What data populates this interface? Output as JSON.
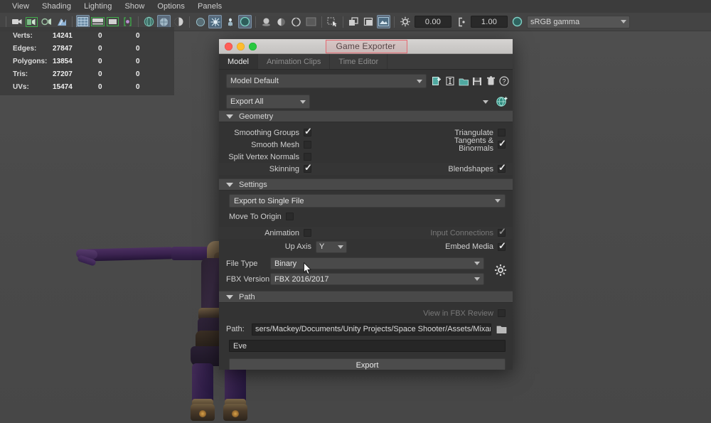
{
  "menubar": {
    "items": [
      {
        "label": "View"
      },
      {
        "label": "Shading"
      },
      {
        "label": "Lighting"
      },
      {
        "label": "Show"
      },
      {
        "label": "Options"
      },
      {
        "label": "Panels"
      }
    ]
  },
  "toolbar": {
    "translate_value": "0.00",
    "scale_value": "1.00",
    "color_space": "sRGB gamma"
  },
  "hud": {
    "columns": [
      "name",
      "col1",
      "col2",
      "col3"
    ],
    "rows": [
      {
        "label": "Verts:",
        "v1": "14241",
        "v2": "0",
        "v3": "0"
      },
      {
        "label": "Edges:",
        "v1": "27847",
        "v2": "0",
        "v3": "0"
      },
      {
        "label": "Polygons:",
        "v1": "13854",
        "v2": "0",
        "v3": "0"
      },
      {
        "label": "Tris:",
        "v1": "27207",
        "v2": "0",
        "v3": "0"
      },
      {
        "label": "UVs:",
        "v1": "15474",
        "v2": "0",
        "v3": "0"
      }
    ]
  },
  "dialog": {
    "title": "Game Exporter",
    "title_highlight_color": "#e46a72",
    "tabs": [
      {
        "label": "Model",
        "active": true
      },
      {
        "label": "Animation Clips",
        "active": false
      },
      {
        "label": "Time Editor",
        "active": false
      }
    ],
    "preset": {
      "value": "Model Default",
      "icons": [
        {
          "name": "new-preset-icon"
        },
        {
          "name": "rename-preset-icon"
        },
        {
          "name": "open-preset-icon"
        },
        {
          "name": "save-preset-icon"
        },
        {
          "name": "delete-preset-icon"
        },
        {
          "name": "help-icon"
        }
      ]
    },
    "export_scope": {
      "value": "Export All",
      "selection_value": ""
    },
    "geometry": {
      "header": "Geometry",
      "left_options": [
        {
          "label": "Smoothing Groups",
          "checked": true,
          "disabled": false
        },
        {
          "label": "Smooth Mesh",
          "checked": false,
          "disabled": false
        },
        {
          "label": "Split Vertex Normals",
          "checked": false,
          "disabled": false
        },
        {
          "label": "Skinning",
          "checked": true,
          "disabled": false
        }
      ],
      "right_options": [
        {
          "label": "Triangulate",
          "checked": false,
          "disabled": false
        },
        {
          "label": "Tangents & Binormals",
          "checked": true,
          "disabled": false
        },
        {
          "label": "Blendshapes",
          "checked": true,
          "disabled": false
        }
      ]
    },
    "settings": {
      "header": "Settings",
      "file_mode": "Export to Single File",
      "move_to_origin": {
        "label": "Move To Origin",
        "checked": false
      },
      "animation": {
        "label": "Animation",
        "checked": false
      },
      "input_connections": {
        "label": "Input Connections",
        "checked": true,
        "disabled": true
      },
      "up_axis": {
        "label": "Up Axis",
        "value": "Y"
      },
      "embed_media": {
        "label": "Embed Media",
        "checked": true
      },
      "file_type": {
        "label": "File Type",
        "value": "Binary"
      },
      "fbx_version": {
        "label": "FBX Version",
        "value": "FBX 2016/2017"
      }
    },
    "path": {
      "header": "Path",
      "view_in_fbx_review": {
        "label": "View in FBX Review",
        "checked": false
      },
      "path_label": "Path:",
      "path_value": "sers/Mackey/Documents/Unity Projects/Space Shooter/Assets/Mixamo",
      "file_name": "Eve",
      "export_button": "Export"
    }
  }
}
